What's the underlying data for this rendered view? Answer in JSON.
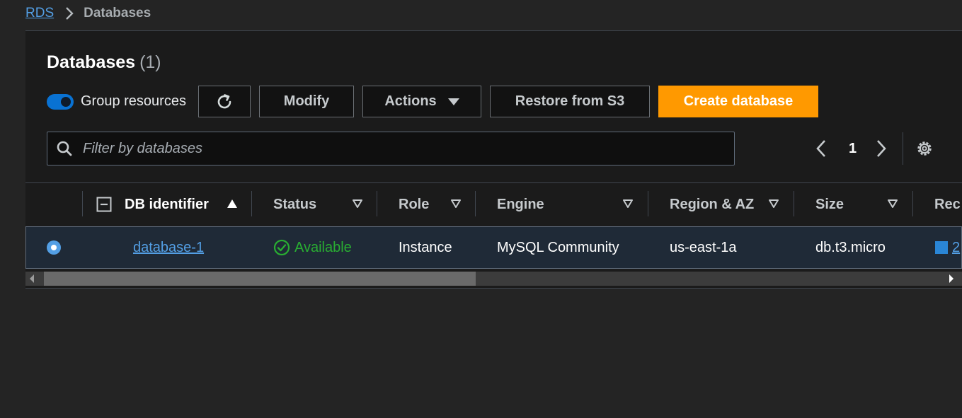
{
  "breadcrumb": {
    "root": "RDS",
    "current": "Databases"
  },
  "header": {
    "title": "Databases",
    "count": "(1)"
  },
  "toolbar": {
    "group_toggle_label": "Group resources",
    "group_toggle_on": true,
    "refresh_icon": "refresh-icon",
    "modify_label": "Modify",
    "actions_label": "Actions",
    "restore_label": "Restore from S3",
    "create_label": "Create database"
  },
  "search": {
    "placeholder": "Filter by databases",
    "value": ""
  },
  "pagination": {
    "current_page": "1"
  },
  "table": {
    "columns": [
      "DB identifier",
      "Status",
      "Role",
      "Engine",
      "Region & AZ",
      "Size",
      "Rec"
    ],
    "rows": [
      {
        "db_identifier": "database-1",
        "status": "Available",
        "role": "Instance",
        "engine": "MySQL Community",
        "region_az": "us-east-1a",
        "size": "db.t3.micro",
        "rec": "2"
      }
    ]
  },
  "colors": {
    "accent": "#539fe5",
    "primary_button": "#ff9900",
    "status_available": "#29ad32",
    "selected_row": "#1f2a37"
  }
}
